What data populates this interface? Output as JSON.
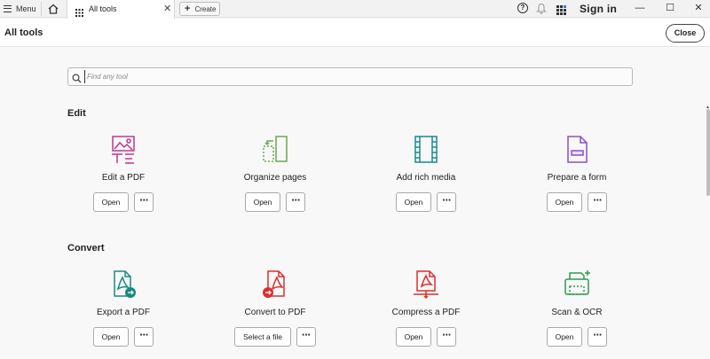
{
  "topbar": {
    "menu_label": "Menu",
    "tab_label": "All tools",
    "tab_close": "✕",
    "create_label": "Create",
    "help": "?",
    "signin_label": "Sign in",
    "minimize": "—",
    "maximize": "☐",
    "close_window": "✕"
  },
  "header": {
    "title": "All tools",
    "close_label": "Close"
  },
  "search": {
    "placeholder": "Find any tool",
    "value": ""
  },
  "sections": [
    {
      "title": "Edit",
      "tools": [
        {
          "label": "Edit a PDF",
          "button": "Open",
          "more": "⋯",
          "icon": "edit-pdf-icon"
        },
        {
          "label": "Organize pages",
          "button": "Open",
          "more": "⋯",
          "icon": "organize-pages-icon"
        },
        {
          "label": "Add rich media",
          "button": "Open",
          "more": "⋯",
          "icon": "rich-media-icon"
        },
        {
          "label": "Prepare a form",
          "button": "Open",
          "more": "⋯",
          "icon": "prepare-form-icon"
        }
      ]
    },
    {
      "title": "Convert",
      "tools": [
        {
          "label": "Export a PDF",
          "button": "Open",
          "more": "⋯",
          "icon": "export-pdf-icon"
        },
        {
          "label": "Convert to PDF",
          "button": "Select a file",
          "more": "⋯",
          "icon": "convert-pdf-icon"
        },
        {
          "label": "Compress a PDF",
          "button": "Open",
          "more": "⋯",
          "icon": "compress-pdf-icon"
        },
        {
          "label": "Scan & OCR",
          "button": "Open",
          "more": "⋯",
          "icon": "scan-ocr-icon"
        }
      ]
    }
  ],
  "colors": {
    "edit": "#c2368f",
    "organize": "#6aa84f",
    "media": "#178c8c",
    "form": "#8a4fcf",
    "export": "#1a8a80",
    "pdf_red": "#d9312f",
    "scan": "#2e9c4a"
  }
}
